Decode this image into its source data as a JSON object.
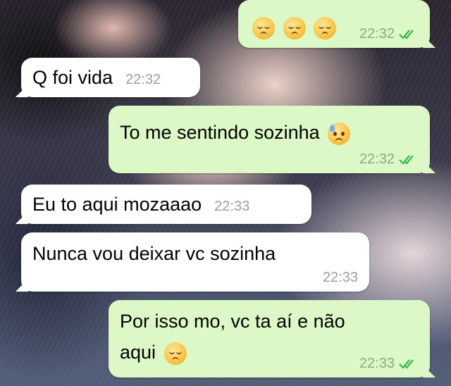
{
  "messages": [
    {
      "direction": "outgoing",
      "text": "",
      "emojis": [
        "pensive-face-emoji",
        "pensive-face-emoji",
        "pensive-face-emoji"
      ],
      "time": "22:32",
      "status": "read"
    },
    {
      "direction": "incoming",
      "text": "Q foi vida",
      "time": "22:32"
    },
    {
      "direction": "outgoing",
      "text": "To me sentindo sozinha",
      "emojis": [
        "disappointed-relieved-face-emoji"
      ],
      "time": "22:32",
      "status": "read"
    },
    {
      "direction": "incoming",
      "text": "Eu to aqui mozaaao",
      "time": "22:33"
    },
    {
      "direction": "incoming",
      "text": "Nunca vou deixar vc sozinha",
      "time": "22:33"
    },
    {
      "direction": "outgoing",
      "text_line1": "Por isso mo, vc ta aí e não",
      "text_line2": "aqui",
      "emojis": [
        "pensive-face-emoji"
      ],
      "time": "22:33",
      "status": "read"
    }
  ],
  "colors": {
    "incoming_bubble": "#ffffff",
    "outgoing_bubble": "#dcf8c6",
    "read_ticks": "#34b746",
    "timestamp": "#9aa09a"
  }
}
